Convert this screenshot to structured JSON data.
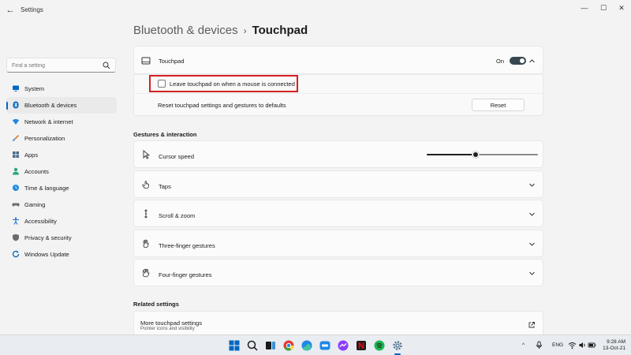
{
  "window": {
    "app_title": "Settings",
    "back_glyph": "←",
    "minimize_glyph": "—",
    "maximize_glyph": "☐",
    "close_glyph": "✕"
  },
  "search": {
    "placeholder": "Find a setting",
    "icon": "search-icon"
  },
  "sidebar": {
    "items": [
      {
        "label": "System",
        "icon": "monitor-icon",
        "color": "#0067c0"
      },
      {
        "label": "Bluetooth & devices",
        "icon": "bluetooth-icon",
        "color": "#0067c0"
      },
      {
        "label": "Network & internet",
        "icon": "wifi-icon",
        "color": "#1e88e5"
      },
      {
        "label": "Personalization",
        "icon": "brush-icon",
        "color": "#d97a2b"
      },
      {
        "label": "Apps",
        "icon": "apps-icon",
        "color": "#4a6b8a"
      },
      {
        "label": "Accounts",
        "icon": "person-icon",
        "color": "#2ea37a"
      },
      {
        "label": "Time & language",
        "icon": "globe-clock-icon",
        "color": "#1e88e5"
      },
      {
        "label": "Gaming",
        "icon": "gamepad-icon",
        "color": "#6b6b6b"
      },
      {
        "label": "Accessibility",
        "icon": "accessibility-icon",
        "color": "#1e6fd9"
      },
      {
        "label": "Privacy & security",
        "icon": "shield-icon",
        "color": "#6b6b6b"
      },
      {
        "label": "Windows Update",
        "icon": "update-icon",
        "color": "#0067c0"
      }
    ],
    "active_index": 1
  },
  "breadcrumb": {
    "parent": "Bluetooth & devices",
    "separator": "›",
    "current": "Touchpad"
  },
  "touchpad_card": {
    "label": "Touchpad",
    "toggle_state": "On",
    "checkbox_label": "Leave touchpad on when a mouse is connected",
    "checkbox_checked": false,
    "reset_label": "Reset touchpad settings and gestures to defaults",
    "reset_button": "Reset"
  },
  "gestures": {
    "section_title": "Gestures & interaction",
    "cursor_speed_label": "Cursor speed",
    "cursor_speed_fraction": 0.44,
    "rows": [
      {
        "label": "Taps",
        "icon": "tap-icon"
      },
      {
        "label": "Scroll & zoom",
        "icon": "scroll-icon"
      },
      {
        "label": "Three-finger gestures",
        "icon": "three-finger-icon"
      },
      {
        "label": "Four-finger gestures",
        "icon": "four-finger-icon"
      }
    ]
  },
  "related": {
    "section_title": "Related settings",
    "item_label": "More touchpad settings",
    "item_sub": "Pointer icons and visibility",
    "item_icon": "external-link-icon"
  },
  "taskbar": {
    "language": "ENG",
    "time": "9:28 AM",
    "date": "13-Oct-21",
    "tray_chevron": "^",
    "accent": "#0067c0"
  }
}
